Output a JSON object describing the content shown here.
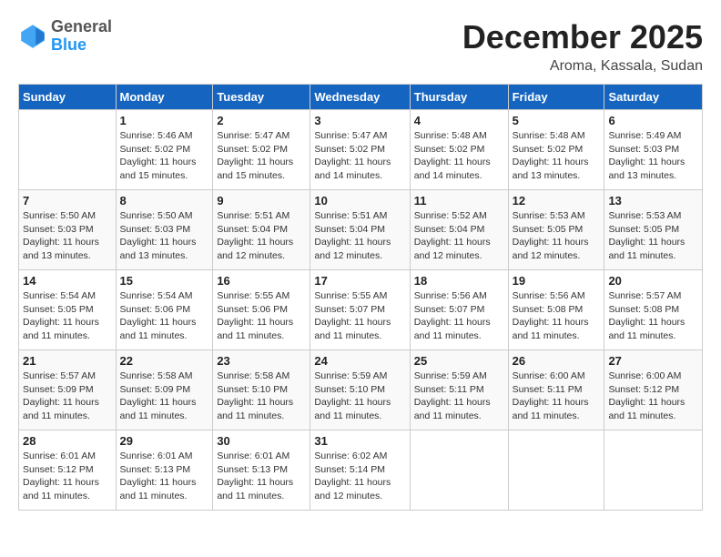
{
  "logo": {
    "general": "General",
    "blue": "Blue"
  },
  "header": {
    "month_year": "December 2025",
    "location": "Aroma, Kassala, Sudan"
  },
  "weekdays": [
    "Sunday",
    "Monday",
    "Tuesday",
    "Wednesday",
    "Thursday",
    "Friday",
    "Saturday"
  ],
  "weeks": [
    [
      {
        "day": "",
        "info": ""
      },
      {
        "day": "1",
        "info": "Sunrise: 5:46 AM\nSunset: 5:02 PM\nDaylight: 11 hours\nand 15 minutes."
      },
      {
        "day": "2",
        "info": "Sunrise: 5:47 AM\nSunset: 5:02 PM\nDaylight: 11 hours\nand 15 minutes."
      },
      {
        "day": "3",
        "info": "Sunrise: 5:47 AM\nSunset: 5:02 PM\nDaylight: 11 hours\nand 14 minutes."
      },
      {
        "day": "4",
        "info": "Sunrise: 5:48 AM\nSunset: 5:02 PM\nDaylight: 11 hours\nand 14 minutes."
      },
      {
        "day": "5",
        "info": "Sunrise: 5:48 AM\nSunset: 5:02 PM\nDaylight: 11 hours\nand 13 minutes."
      },
      {
        "day": "6",
        "info": "Sunrise: 5:49 AM\nSunset: 5:03 PM\nDaylight: 11 hours\nand 13 minutes."
      }
    ],
    [
      {
        "day": "7",
        "info": "Sunrise: 5:50 AM\nSunset: 5:03 PM\nDaylight: 11 hours\nand 13 minutes."
      },
      {
        "day": "8",
        "info": "Sunrise: 5:50 AM\nSunset: 5:03 PM\nDaylight: 11 hours\nand 13 minutes."
      },
      {
        "day": "9",
        "info": "Sunrise: 5:51 AM\nSunset: 5:04 PM\nDaylight: 11 hours\nand 12 minutes."
      },
      {
        "day": "10",
        "info": "Sunrise: 5:51 AM\nSunset: 5:04 PM\nDaylight: 11 hours\nand 12 minutes."
      },
      {
        "day": "11",
        "info": "Sunrise: 5:52 AM\nSunset: 5:04 PM\nDaylight: 11 hours\nand 12 minutes."
      },
      {
        "day": "12",
        "info": "Sunrise: 5:53 AM\nSunset: 5:05 PM\nDaylight: 11 hours\nand 12 minutes."
      },
      {
        "day": "13",
        "info": "Sunrise: 5:53 AM\nSunset: 5:05 PM\nDaylight: 11 hours\nand 11 minutes."
      }
    ],
    [
      {
        "day": "14",
        "info": "Sunrise: 5:54 AM\nSunset: 5:05 PM\nDaylight: 11 hours\nand 11 minutes."
      },
      {
        "day": "15",
        "info": "Sunrise: 5:54 AM\nSunset: 5:06 PM\nDaylight: 11 hours\nand 11 minutes."
      },
      {
        "day": "16",
        "info": "Sunrise: 5:55 AM\nSunset: 5:06 PM\nDaylight: 11 hours\nand 11 minutes."
      },
      {
        "day": "17",
        "info": "Sunrise: 5:55 AM\nSunset: 5:07 PM\nDaylight: 11 hours\nand 11 minutes."
      },
      {
        "day": "18",
        "info": "Sunrise: 5:56 AM\nSunset: 5:07 PM\nDaylight: 11 hours\nand 11 minutes."
      },
      {
        "day": "19",
        "info": "Sunrise: 5:56 AM\nSunset: 5:08 PM\nDaylight: 11 hours\nand 11 minutes."
      },
      {
        "day": "20",
        "info": "Sunrise: 5:57 AM\nSunset: 5:08 PM\nDaylight: 11 hours\nand 11 minutes."
      }
    ],
    [
      {
        "day": "21",
        "info": "Sunrise: 5:57 AM\nSunset: 5:09 PM\nDaylight: 11 hours\nand 11 minutes."
      },
      {
        "day": "22",
        "info": "Sunrise: 5:58 AM\nSunset: 5:09 PM\nDaylight: 11 hours\nand 11 minutes."
      },
      {
        "day": "23",
        "info": "Sunrise: 5:58 AM\nSunset: 5:10 PM\nDaylight: 11 hours\nand 11 minutes."
      },
      {
        "day": "24",
        "info": "Sunrise: 5:59 AM\nSunset: 5:10 PM\nDaylight: 11 hours\nand 11 minutes."
      },
      {
        "day": "25",
        "info": "Sunrise: 5:59 AM\nSunset: 5:11 PM\nDaylight: 11 hours\nand 11 minutes."
      },
      {
        "day": "26",
        "info": "Sunrise: 6:00 AM\nSunset: 5:11 PM\nDaylight: 11 hours\nand 11 minutes."
      },
      {
        "day": "27",
        "info": "Sunrise: 6:00 AM\nSunset: 5:12 PM\nDaylight: 11 hours\nand 11 minutes."
      }
    ],
    [
      {
        "day": "28",
        "info": "Sunrise: 6:01 AM\nSunset: 5:12 PM\nDaylight: 11 hours\nand 11 minutes."
      },
      {
        "day": "29",
        "info": "Sunrise: 6:01 AM\nSunset: 5:13 PM\nDaylight: 11 hours\nand 11 minutes."
      },
      {
        "day": "30",
        "info": "Sunrise: 6:01 AM\nSunset: 5:13 PM\nDaylight: 11 hours\nand 11 minutes."
      },
      {
        "day": "31",
        "info": "Sunrise: 6:02 AM\nSunset: 5:14 PM\nDaylight: 11 hours\nand 12 minutes."
      },
      {
        "day": "",
        "info": ""
      },
      {
        "day": "",
        "info": ""
      },
      {
        "day": "",
        "info": ""
      }
    ]
  ]
}
